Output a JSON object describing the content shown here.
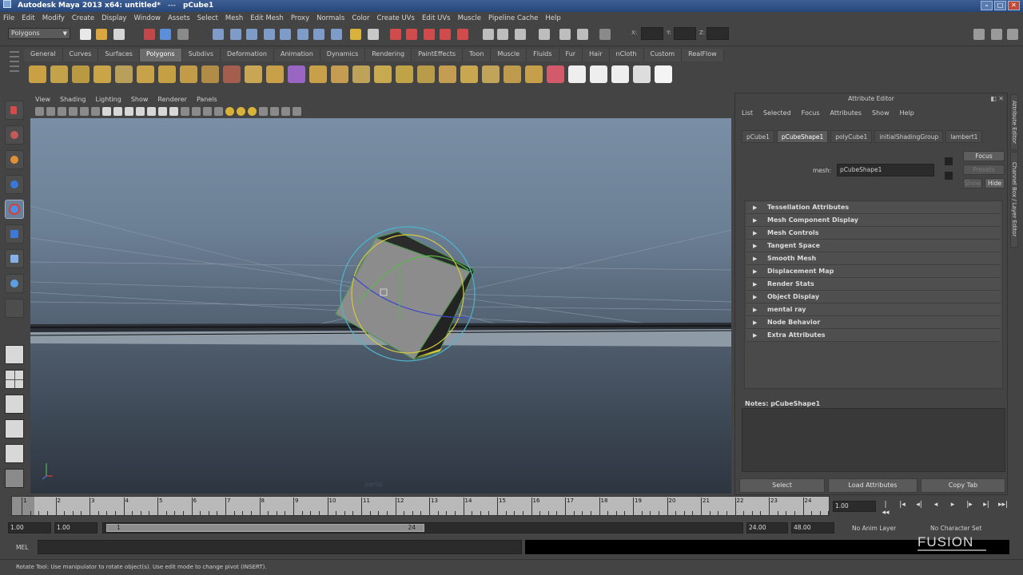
{
  "window": {
    "title": "Autodesk Maya 2013 x64: untitled*",
    "separator": "---",
    "object": "pCube1"
  },
  "menubar": [
    "File",
    "Edit",
    "Modify",
    "Create",
    "Display",
    "Window",
    "Assets",
    "Select",
    "Mesh",
    "Edit Mesh",
    "Proxy",
    "Normals",
    "Color",
    "Create UVs",
    "Edit UVs",
    "Muscle",
    "Pipeline Cache",
    "Help"
  ],
  "statusline": {
    "mode": "Polygons",
    "field_x_label": "X:",
    "field_y_label": "Y:",
    "field_z_label": "Z:"
  },
  "shelf": {
    "tabs": [
      "General",
      "Curves",
      "Surfaces",
      "Polygons",
      "Subdivs",
      "Deformation",
      "Animation",
      "Dynamics",
      "Rendering",
      "PaintEffects",
      "Toon",
      "Muscle",
      "Fluids",
      "Fur",
      "Hair",
      "nCloth",
      "Custom",
      "RealFlow"
    ],
    "active_tab": "Polygons",
    "icon_colors": [
      "#c9a043",
      "#c3a24a",
      "#b99a42",
      "#caa548",
      "#b9a05a",
      "#c8a248",
      "#c49f44",
      "#c19b48",
      "#b08c46",
      "#a35e4d",
      "#c8a654",
      "#c9a04a",
      "#9a66c4",
      "#c9a04a",
      "#c49c52",
      "#bfa25a",
      "#c7a94f",
      "#c0a247",
      "#b99c4a",
      "#c49d52",
      "#c9a751",
      "#c2a35a",
      "#bd9a4c",
      "#c69f4a",
      "#d25a6a",
      "#eeeeee",
      "#eeeeee",
      "#eeeeee",
      "#dddddd",
      "#f4f4f4"
    ]
  },
  "toolbox": {
    "tools": [
      "select-tool",
      "lasso-tool",
      "paint-select-tool",
      "move-tool",
      "rotate-tool",
      "scale-tool",
      "manipulator-tool",
      "last-tool"
    ],
    "active_tool": "rotate-tool"
  },
  "viewport": {
    "menu": [
      "View",
      "Shading",
      "Lighting",
      "Show",
      "Renderer",
      "Panels"
    ],
    "camera_label": "persp"
  },
  "attribute_editor": {
    "title": "Attribute Editor",
    "menu": [
      "List",
      "Selected",
      "Focus",
      "Attributes",
      "Show",
      "Help"
    ],
    "tabs": [
      "pCube1",
      "pCubeShape1",
      "polyCube1",
      "initialShadingGroup",
      "lambert1"
    ],
    "active_tab": "pCubeShape1",
    "mesh_label": "mesh:",
    "mesh_value": "pCubeShape1",
    "focus_label": "Focus",
    "presets_label": "Presets",
    "show_label": "Show",
    "hide_label": "Hide",
    "sections": [
      "Tessellation Attributes",
      "Mesh Component Display",
      "Mesh Controls",
      "Tangent Space",
      "Smooth Mesh",
      "Displacement Map",
      "Render Stats",
      "Object Display",
      "mental ray",
      "Node Behavior",
      "Extra Attributes"
    ],
    "notes_label": "Notes:  pCubeShape1",
    "buttons": [
      "Select",
      "Load Attributes",
      "Copy Tab"
    ],
    "side_tabs": [
      "Attribute Editor",
      "Channel Box / Layer Editor"
    ]
  },
  "timeline": {
    "ticks": [
      1,
      2,
      3,
      4,
      5,
      6,
      7,
      8,
      9,
      10,
      11,
      12,
      13,
      14,
      15,
      16,
      17,
      18,
      19,
      20,
      21,
      22,
      23,
      24
    ],
    "current_frame": "1.00",
    "playback_buttons": [
      "|◂◂",
      "|◂",
      "◂|",
      "◂",
      "▸",
      "|▸",
      "▸|",
      "▸▸|"
    ]
  },
  "range": {
    "start": "1.00",
    "playback_start": "1.00",
    "handle_start": "1",
    "handle_end": "24",
    "playback_end": "24.00",
    "end": "48.00",
    "anim_layer": "No Anim Layer",
    "character_set": "No Character Set"
  },
  "command": {
    "label": "MEL",
    "watermark": "FUSION"
  },
  "helpline": "Rotate Tool: Use manipulator to rotate object(s). Use edit mode to change pivot (INSERT)."
}
